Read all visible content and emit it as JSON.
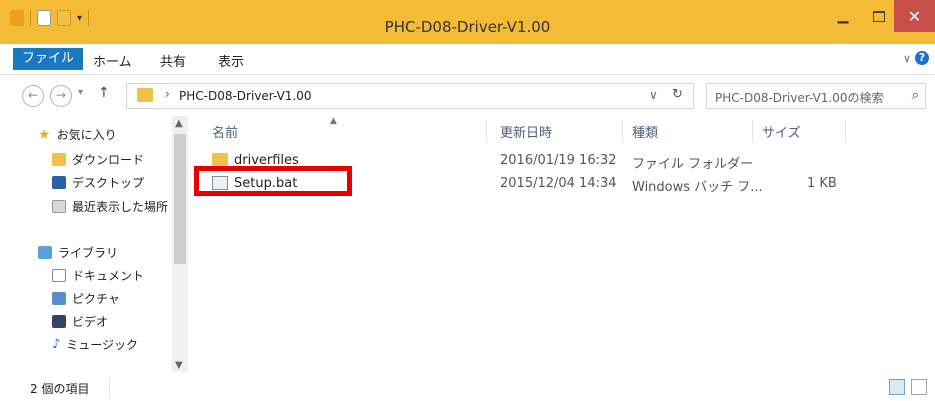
{
  "window": {
    "title": "PHC-D08-Driver-V1.00"
  },
  "ribbon": {
    "tabs": [
      {
        "label": "ファイル"
      },
      {
        "label": "ホーム"
      },
      {
        "label": "共有"
      },
      {
        "label": "表示"
      }
    ],
    "help_label": "?"
  },
  "address": {
    "path": "PHC-D08-Driver-V1.00",
    "search_placeholder": "PHC-D08-Driver-V1.00の検索"
  },
  "sidebar": {
    "items": [
      {
        "label": "お気に入り",
        "icon": "star-icon"
      },
      {
        "label": "ダウンロード",
        "icon": "download-folder-icon"
      },
      {
        "label": "デスクトップ",
        "icon": "desktop-icon"
      },
      {
        "label": "最近表示した場所",
        "icon": "recent-places-icon"
      },
      {
        "label": "ライブラリ",
        "icon": "library-icon"
      },
      {
        "label": "ドキュメント",
        "icon": "documents-icon"
      },
      {
        "label": "ピクチャ",
        "icon": "pictures-icon"
      },
      {
        "label": "ビデオ",
        "icon": "videos-icon"
      },
      {
        "label": "ミュージック",
        "icon": "music-icon"
      }
    ]
  },
  "columns": {
    "name": "名前",
    "modified": "更新日時",
    "type": "種類",
    "size": "サイズ"
  },
  "files": [
    {
      "name": "driverfiles",
      "modified": "2016/01/19 16:32",
      "type": "ファイル フォルダー",
      "size": "",
      "icon": "folder-icon"
    },
    {
      "name": "Setup.bat",
      "modified": "2015/12/04 14:34",
      "type": "Windows バッチ フ...",
      "size": "1 KB",
      "icon": "batch-file-icon"
    }
  ],
  "status": {
    "count": "2 個の項目"
  },
  "colors": {
    "titlebar": "#f4bc36",
    "file_tab": "#1a78c2",
    "close": "#c74f4a",
    "highlight": "#e60000"
  }
}
